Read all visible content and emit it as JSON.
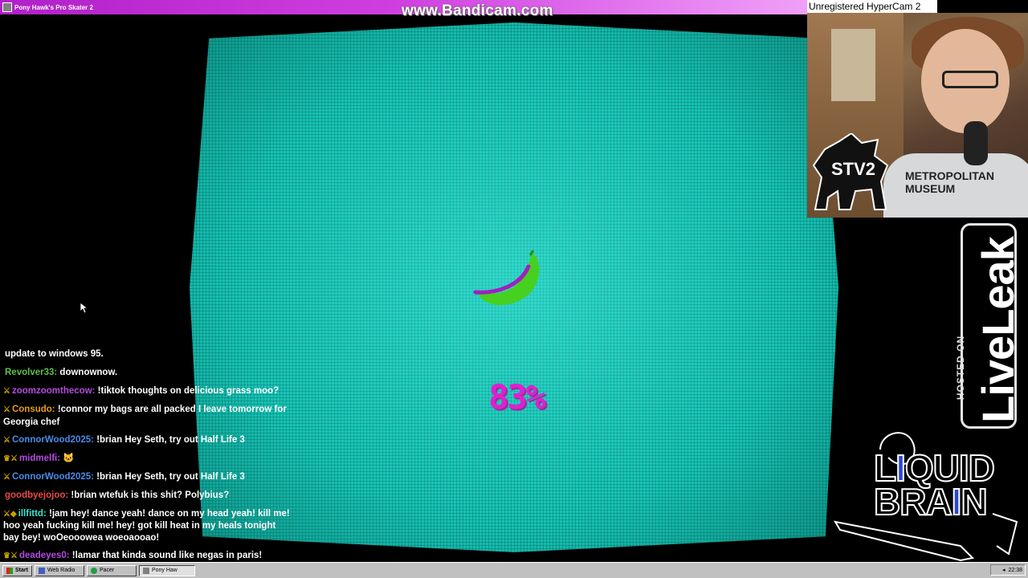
{
  "window": {
    "title": "Pony Hawk's Pro Skater 2"
  },
  "overlays": {
    "watermark": "www.Bandicam.com",
    "hypercam": "Unregistered HyperCam 2",
    "stv": "STV2",
    "webcam_shirt": "METROPOLITAN\nMUSEUM"
  },
  "game": {
    "progress_text": "83%",
    "progress_value": 0.83,
    "loading_icon": "banana-icon",
    "screen_color": "#16c4b6",
    "percent_color": "#e020d0"
  },
  "liveleak": {
    "hosted": "HOSTED ON",
    "brand": "LiveLeak"
  },
  "liquidbrain": {
    "line1_a": "L",
    "line1_b": "I",
    "line1_c": "QUID",
    "line2_a": "BRA",
    "line2_b": "I",
    "line2_c": "N"
  },
  "chat": {
    "messages": [
      {
        "user": "",
        "user_color": "#ffffff",
        "badge": "",
        "text": "update to windows 95."
      },
      {
        "user": "Revolver33:",
        "user_color": "#5ec04a",
        "badge": "",
        "text": "downownow."
      },
      {
        "user": "zoomzoomthecow:",
        "user_color": "#b44ae0",
        "badge": "⚔",
        "text": "!tiktok thoughts on delicious grass moo?"
      },
      {
        "user": "Consudo:",
        "user_color": "#e89a1a",
        "badge": "⚔",
        "text": "!connor my bags are all packed I leave tomorrow for Georgia chef"
      },
      {
        "user": "ConnorWood2025:",
        "user_color": "#4a8ae8",
        "badge": "⚔",
        "text": "!brian Hey Seth, try out Half Life 3"
      },
      {
        "user": "midmelfi:",
        "user_color": "#b44ae0",
        "badge": "♛⚔",
        "text": "🐱"
      },
      {
        "user": "ConnorWood2025:",
        "user_color": "#4a8ae8",
        "badge": "⚔",
        "text": "!brian Hey Seth, try out Half Life 3"
      },
      {
        "user": "goodbyejojoo:",
        "user_color": "#e84a4a",
        "badge": "",
        "text": "!brian wtefuk is this shit? Polybius?"
      },
      {
        "user": "illfittd:",
        "user_color": "#3ae0d0",
        "badge": "⚔◆",
        "text": "!jam hey! dance yeah! dance on my head yeah! kill me! hoo yeah fucking kill me! hey! got kill heat in my heals tonight bay bey! woOeooowea woeoaooao!"
      },
      {
        "user": "deadeyes0:",
        "user_color": "#b44ae0",
        "badge": "♛⚔",
        "text": "!lamar that kinda sound like negas in paris!"
      }
    ]
  },
  "taskbar": {
    "start": "Start",
    "items": [
      "Web Radio",
      "Pacer",
      "Pony Haw"
    ],
    "clock": "22:38"
  }
}
